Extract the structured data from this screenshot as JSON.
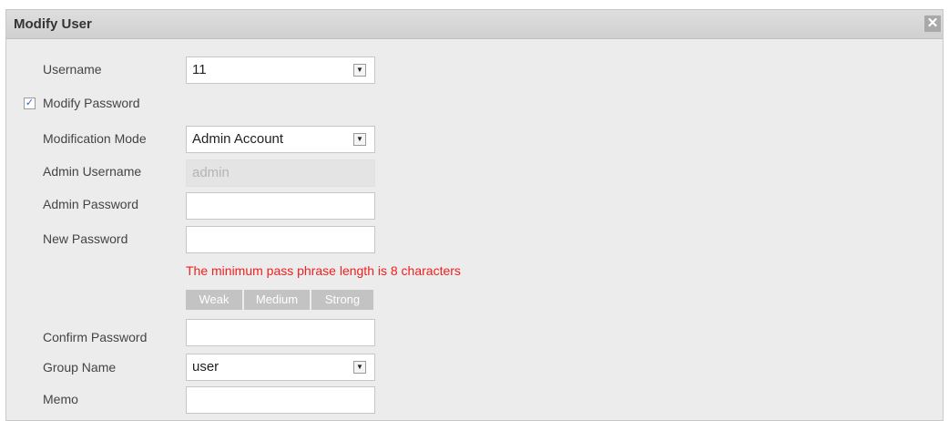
{
  "dialog": {
    "title": "Modify User",
    "close_glyph": "✕"
  },
  "form": {
    "username_label": "Username",
    "username_value": "11",
    "modify_password_label": "Modify Password",
    "modify_password_checked": true,
    "check_glyph": "✓",
    "modification_mode_label": "Modification Mode",
    "modification_mode_value": "Admin Account",
    "admin_username_label": "Admin Username",
    "admin_username_value": "admin",
    "admin_password_label": "Admin Password",
    "admin_password_value": "",
    "new_password_label": "New Password",
    "new_password_value": "",
    "password_hint": "The minimum pass phrase length is 8 characters",
    "strength_levels": [
      "Weak",
      "Medium",
      "Strong"
    ],
    "confirm_password_label": "Confirm Password",
    "confirm_password_value": "",
    "group_name_label": "Group Name",
    "group_name_value": "user",
    "memo_label": "Memo",
    "memo_value": "",
    "dropdown_glyph": "▼"
  },
  "colors": {
    "hint": "#ef2020",
    "strength_bar": "#c3c3c3",
    "checkbox_mark": "#3a63c5"
  },
  "icons": {
    "close": "close-icon",
    "dropdown": "chevron-down-icon",
    "check": "check-icon"
  }
}
